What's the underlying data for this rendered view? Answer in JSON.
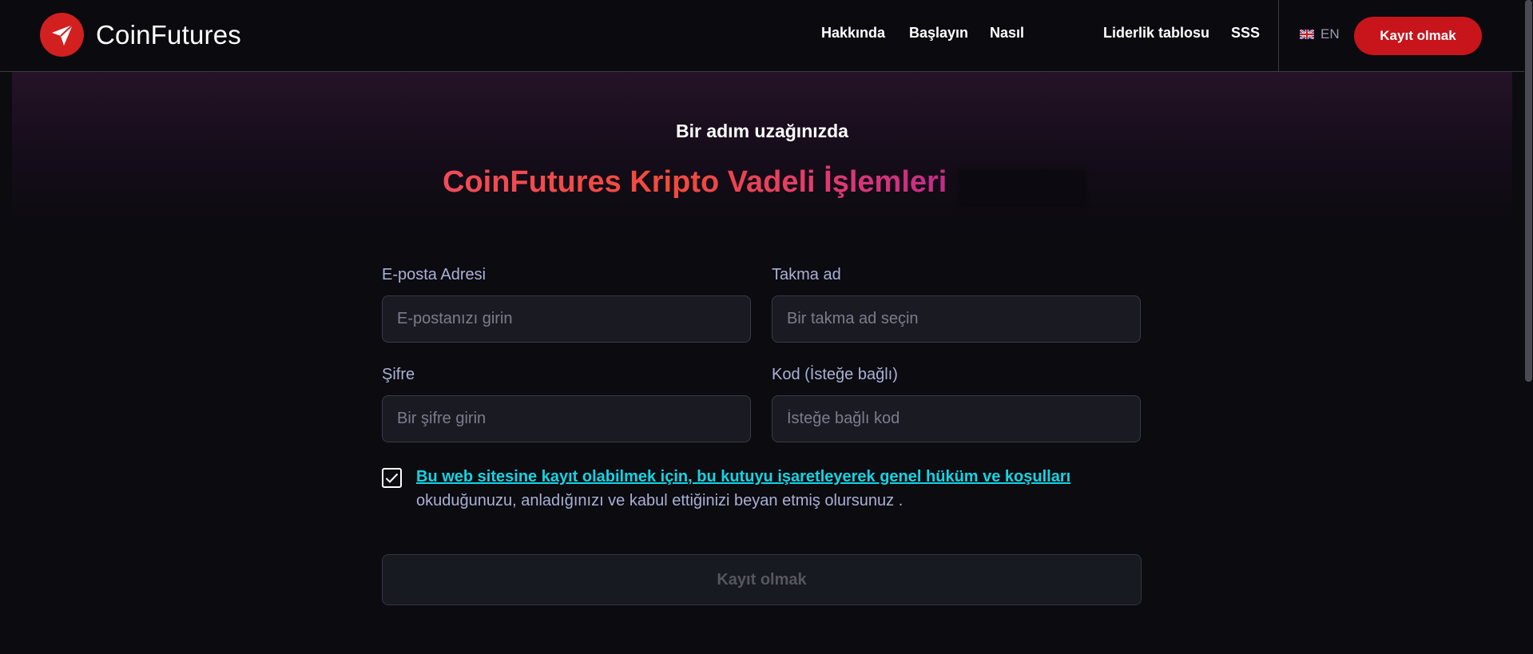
{
  "brand": {
    "name": "CoinFutures",
    "accent_color": "#d21f1f"
  },
  "nav": {
    "items": [
      {
        "label": "Hakkında"
      },
      {
        "label": "Başlayın"
      },
      {
        "label": "Nasıl"
      },
      {
        "label": "Liderlik tablosu"
      },
      {
        "label": "SSS"
      }
    ],
    "language": "EN",
    "language_icon": "uk-flag-icon",
    "cta_label": "Kayıt olmak"
  },
  "hero": {
    "subtitle": "Bir adım uzağınızda",
    "headline": "CoinFutures Kripto Vadeli İşlemleri",
    "headline_gradient": [
      "#f24a5a",
      "#c32b8a"
    ]
  },
  "form": {
    "email": {
      "label": "E-posta Adresi",
      "placeholder": "E-postanızı girin",
      "value": ""
    },
    "nickname": {
      "label": "Takma ad",
      "placeholder": "Bir takma ad seçin",
      "value": ""
    },
    "password": {
      "label": "Şifre",
      "placeholder": "Bir şifre girin",
      "value": ""
    },
    "code": {
      "label": "Kod (İsteğe bağlı)",
      "placeholder": "İsteğe bağlı kod",
      "value": ""
    },
    "terms_checked": true,
    "terms_link": "Bu web sitesine kayıt olabilmek için, bu kutuyu işaretleyerek genel hüküm ve koşulları",
    "terms_rest": "okuduğunuzu, anladığınızı ve kabul ettiğinizi beyan etmiş olursunuz .",
    "submit_label": "Kayıt olmak"
  },
  "colors": {
    "background": "#0b0b10",
    "link": "#14d4e4",
    "label": "#a9b1d6",
    "cta": "#c8141b"
  }
}
